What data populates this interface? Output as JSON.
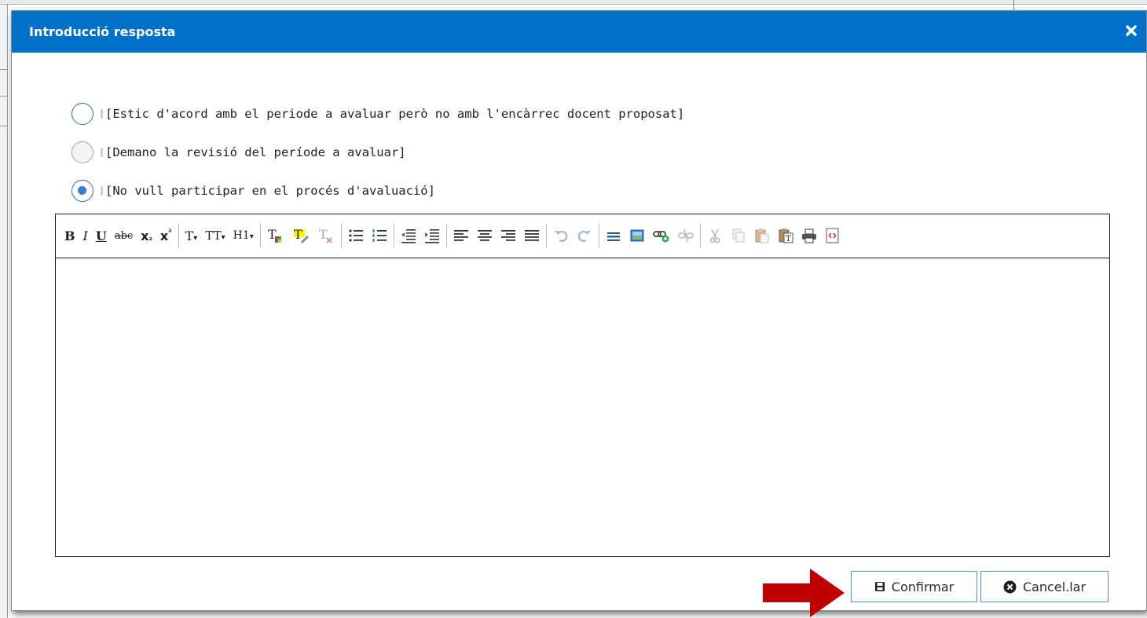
{
  "dialog": {
    "title": "Introducció resposta",
    "close_icon": "close-icon"
  },
  "options": [
    {
      "label": "[Estic d'acord amb el periode a avaluar però no amb l'encàrrec docent proposat]",
      "checked": false
    },
    {
      "label": "[Demano la revisió del període a avaluar]",
      "checked": false
    },
    {
      "label": "[No vull participar en el procés d'avaluació]",
      "checked": true
    }
  ],
  "editor": {
    "toolbar_icons": [
      "bold-icon",
      "italic-icon",
      "underline-icon",
      "strikethrough-icon",
      "subscript-icon",
      "superscript-icon",
      "font-family-icon",
      "font-size-icon",
      "heading-icon",
      "text-color-icon",
      "highlight-icon",
      "clear-format-icon",
      "bullet-list-icon",
      "numbered-list-icon",
      "outdent-icon",
      "indent-icon",
      "align-left-icon",
      "align-center-icon",
      "align-right-icon",
      "align-justify-icon",
      "undo-icon",
      "redo-icon",
      "horizontal-rule-icon",
      "image-icon",
      "link-icon",
      "unlink-icon",
      "cut-icon",
      "copy-icon",
      "paste-icon",
      "paste-text-icon",
      "print-icon",
      "source-code-icon"
    ],
    "labels": {
      "bold": "B",
      "italic": "I",
      "underline": "U",
      "strike": "abc",
      "sub": "x",
      "sub_mark": "₂",
      "sup": "x",
      "sup_mark": "²",
      "font": "T",
      "size": "TT",
      "heading": "H1",
      "caret": "▾"
    }
  },
  "buttons": {
    "confirm": "Confirmar",
    "cancel": "Cancel.lar"
  },
  "colors": {
    "titlebar": "#0071c9",
    "arrow": "#c00000",
    "button_border": "#4a8fd8"
  }
}
